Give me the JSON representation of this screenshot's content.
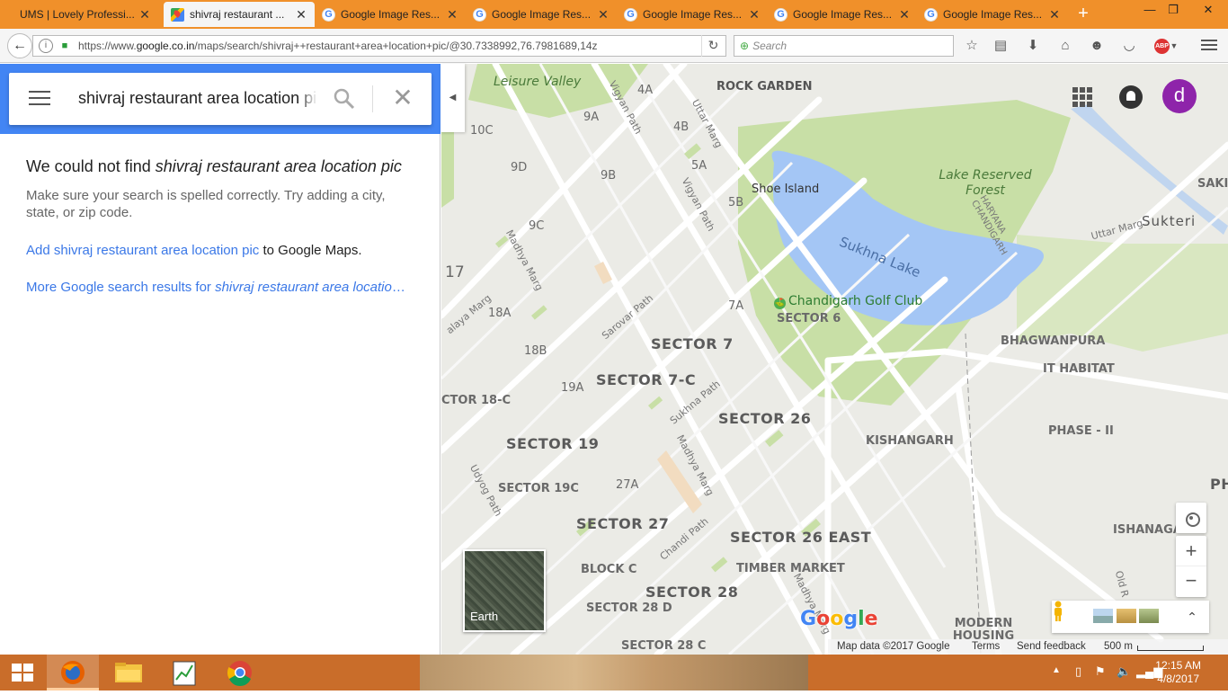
{
  "browser": {
    "tabs": [
      {
        "title": "UMS | Lovely Professi...",
        "active": false,
        "icon": "ums-favicon"
      },
      {
        "title": "shivraj restaurant ...",
        "active": true,
        "icon": "google-maps-icon"
      },
      {
        "title": "Google Image Res...",
        "active": false,
        "icon": "google-icon"
      },
      {
        "title": "Google Image Res...",
        "active": false,
        "icon": "google-icon"
      },
      {
        "title": "Google Image Res...",
        "active": false,
        "icon": "google-icon"
      },
      {
        "title": "Google Image Res...",
        "active": false,
        "icon": "google-icon"
      },
      {
        "title": "Google Image Res...",
        "active": false,
        "icon": "google-icon"
      }
    ],
    "url_prefix": "https://www.",
    "url_host": "google.co.in",
    "url_path": "/maps/search/shivraj++restaurant+area+location+pic/@30.7338992,76.7981689,14z",
    "search_placeholder": "Search",
    "abp_label": "ABP",
    "accent": "#f0902a"
  },
  "maps": {
    "search_query": "shivraj  restaurant area location pic",
    "not_found_prefix": "We could not find ",
    "not_found_query": "shivraj restaurant area location pic",
    "hint": "Make sure your search is spelled correctly. Try adding a city, state, or zip code.",
    "add_link": "Add shivraj restaurant area location pic",
    "add_suffix": " to Google Maps.",
    "more_prefix": "More Google search results for ",
    "more_query": "shivraj restaurant area location pic",
    "avatar_letter": "d",
    "earth_label": "Earth",
    "logo": "Google",
    "footer": {
      "map_data": "Map data ©2017 Google",
      "terms": "Terms",
      "feedback": "Send feedback",
      "scale": "500 m"
    },
    "labels": {
      "leisure_valley": "Leisure Valley",
      "rock_garden": "ROCK GARDEN",
      "shoe_island": "Shoe Island",
      "lake_reserved_forest": "Lake Reserved Forest",
      "sukhna_lake": "Sukhna Lake",
      "golf_club": "Chandigarh Golf Club",
      "sector6": "SECTOR 6",
      "sector7": "SECTOR 7",
      "sector7c": "SECTOR 7-C",
      "sector26": "SECTOR 26",
      "sector19": "SECTOR 19",
      "sector19c": "SECTOR 19C",
      "sector27": "SECTOR 27",
      "sector26east": "SECTOR 26 EAST",
      "timber": "TIMBER MARKET",
      "sector28": "SECTOR 28",
      "sector28d": "SECTOR 28 D",
      "sector28c": "SECTOR 28 C",
      "block_c": "BLOCK C",
      "kishangarh": "KISHANGARH",
      "bhagwanpura": "BHAGWANPURA",
      "it_habitat": "IT HABITAT",
      "phase2": "PHASE - II",
      "ishanagar": "ISHANAGAR",
      "modern_housing": "MODERN HOUSING",
      "sukteri": "Sukteri",
      "haryana_chandigarh": "HARYANA CHANDIGARH",
      "s4a": "4A",
      "s9a": "9A",
      "s10c": "10C",
      "s4b": "4B",
      "s5a": "5A",
      "s9d": "9D",
      "s9b": "9B",
      "s5b": "5B",
      "s9c": "9C",
      "s17": "17",
      "s18a": "18A",
      "s7a": "7A",
      "s18b": "18B",
      "s19a": "19A",
      "s18c": "CTOR 18-C",
      "s27a": "27A",
      "vigyan_path": "Vigyan Path",
      "uttar_marg": "Uttar Marg",
      "madhya_marg": "Madhya Marg",
      "sarovar_path": "Sarovar Path",
      "sukhna_path": "Sukhna Path",
      "udyog_path": "Udyog Path",
      "chandi_path": "Chandi Path",
      "uttar_marg2": "Uttar Marg",
      "madhya_marg2": "Madhya Marg",
      "dakshin_marg_frag": "alaya Marg",
      "old_road": "Old R",
      "saki": "SAKI",
      "pha": "PHA"
    }
  },
  "taskbar": {
    "time": "12:15 AM",
    "date": "4/8/2017"
  }
}
